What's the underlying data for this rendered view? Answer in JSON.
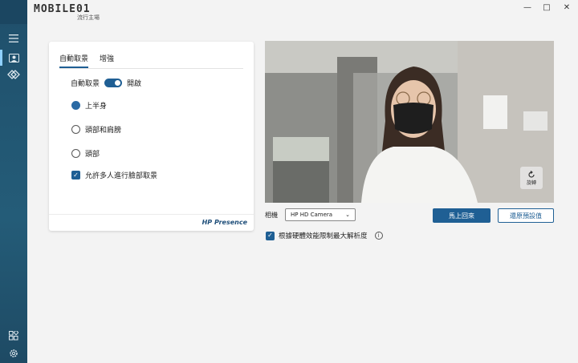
{
  "window": {
    "logo_text": "MOBILE01",
    "logo_sub": "流行主場",
    "minimize": "—",
    "maximize": "□",
    "close": "✕"
  },
  "tabs": [
    {
      "label": "自動取景",
      "active": true
    },
    {
      "label": "增強",
      "active": false
    }
  ],
  "auto_frame": {
    "label": "自動取景",
    "toggle_state": "開啟",
    "enabled": true
  },
  "options": [
    {
      "label": "上半身",
      "selected": true
    },
    {
      "label": "頭部和肩膀",
      "selected": false
    },
    {
      "label": "頭部",
      "selected": false
    }
  ],
  "multi_person": {
    "label": "允許多人進行臉部取景",
    "checked": true
  },
  "brand": "HP Presence",
  "preview": {
    "rotate_label": "旋轉"
  },
  "camera": {
    "label": "相機",
    "selected": "HP HD Camera"
  },
  "buttons": {
    "apply": "馬上回來",
    "reset": "還原預設值"
  },
  "resolution": {
    "label": "根據硬體效能限制最大解析度",
    "checked": true
  },
  "colors": {
    "accent": "#1f5f94",
    "rail": "#245c78"
  }
}
